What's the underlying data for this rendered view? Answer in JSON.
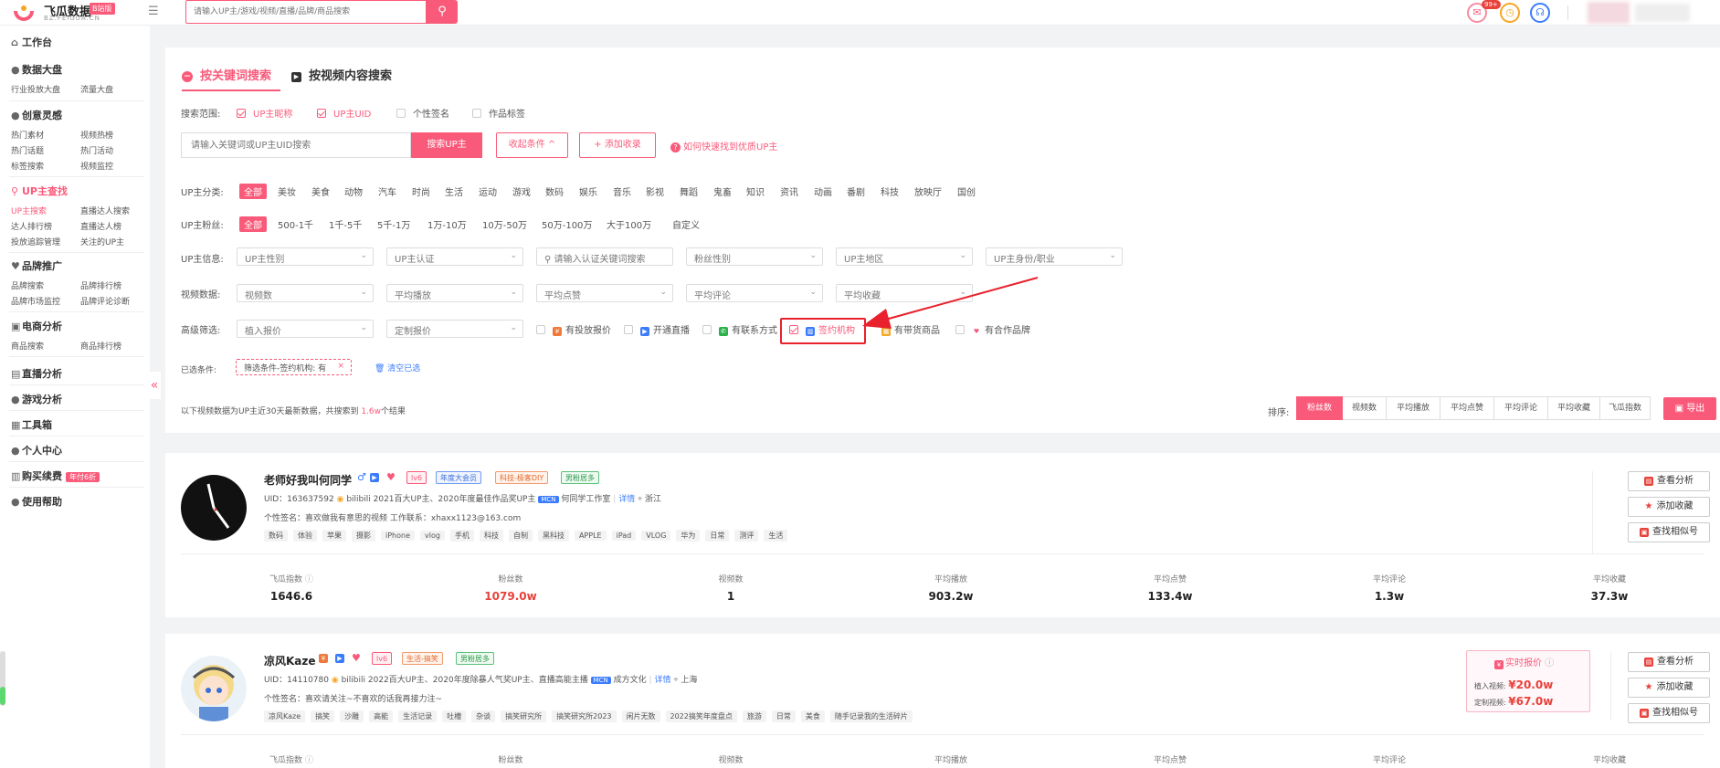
{
  "header": {
    "logo_name": "飞瓜数据",
    "logo_badge": "B站版",
    "logo_domain": "BZ.FEIGUA.CN",
    "search_placeholder": "请输入UP主/游戏/视频/直播/品牌/商品搜索",
    "notification_count": "99+",
    "colors": {
      "accent": "#fa5a7a"
    }
  },
  "sidebar": {
    "workbench": "工作台",
    "data_screen": "数据大盘",
    "data_screen_items": [
      "行业投放大盘",
      "流量大盘"
    ],
    "inspiration": "创意灵感",
    "inspiration_items": [
      "热门素材",
      "视频热榜",
      "热门话题",
      "热门活动",
      "标签搜索",
      "视频监控"
    ],
    "up_search": "UP主查找",
    "up_search_items": [
      "UP主搜索",
      "直播达人搜索",
      "达人排行榜",
      "直播达人榜",
      "投放追踪管理",
      "关注的UP主"
    ],
    "brand": "品牌推广",
    "brand_items": [
      "品牌搜索",
      "品牌排行榜",
      "品牌市场监控",
      "品牌评论诊断"
    ],
    "ecommerce": "电商分析",
    "ecommerce_items": [
      "商品搜索",
      "商品排行榜"
    ],
    "live": "直播分析",
    "game": "游戏分析",
    "tools": "工具箱",
    "personal": "个人中心",
    "purchase": "购买续费",
    "purchase_badge": "年付6折",
    "help": "使用帮助"
  },
  "search_panel": {
    "tab_keyword": "按关键词搜索",
    "tab_video": "按视频内容搜索",
    "scope_label": "搜索范围:",
    "scope_options": [
      {
        "label": "UP主昵称",
        "checked": true
      },
      {
        "label": "UP主UID",
        "checked": true
      },
      {
        "label": "个性签名",
        "checked": false
      },
      {
        "label": "作品标签",
        "checked": false
      }
    ],
    "keyword_placeholder": "请输入关键词或UP主UID搜索",
    "search_button": "搜索UP主",
    "collapse_button": "收起条件 ^",
    "add_favorite_button": "+ 添加收录",
    "help_link": "如何快速找到优质UP主",
    "category_label": "UP主分类:",
    "categories": [
      "全部",
      "美妆",
      "美食",
      "动物",
      "汽车",
      "时尚",
      "生活",
      "运动",
      "游戏",
      "数码",
      "娱乐",
      "音乐",
      "影视",
      "舞蹈",
      "鬼畜",
      "知识",
      "资讯",
      "动画",
      "番剧",
      "科技",
      "放映厅",
      "国创"
    ],
    "fans_label": "UP主粉丝:",
    "fans_ranges": [
      "全部",
      "500-1千",
      "1千-5千",
      "5千-1万",
      "1万-10万",
      "10万-50万",
      "50万-100万",
      "大于100万",
      "自定义"
    ],
    "info_label": "UP主信息:",
    "info_selects": [
      "UP主性别",
      "UP主认证",
      "请输入认证关键词搜索",
      "粉丝性别",
      "UP主地区",
      "UP主身份/职业"
    ],
    "video_label": "视频数据:",
    "video_selects": [
      "视频数",
      "平均播放",
      "平均点赞",
      "平均评论",
      "平均收藏"
    ],
    "advanced_label": "高级筛选:",
    "advanced_selects": [
      "植入报价",
      "定制报价"
    ],
    "advanced_checks": [
      {
        "label": "有投放报价",
        "checked": false,
        "icon_color": "#f07a3c"
      },
      {
        "label": "开通直播",
        "checked": false,
        "icon_color": "#3b7cff"
      },
      {
        "label": "有联系方式",
        "checked": false,
        "icon_color": "#2bb04a"
      },
      {
        "label": "签约机构",
        "checked": true,
        "icon_color": "#3b7cff"
      },
      {
        "label": "有带货商品",
        "checked": false,
        "icon_color": "#f5a623"
      },
      {
        "label": "有合作品牌",
        "checked": false,
        "icon_color": "#fa5a7a"
      }
    ],
    "selected_label": "已选条件:",
    "selected_chip": "筛选条件-签约机构: 有",
    "clear_label": "清空已选"
  },
  "results_bar": {
    "summary_prefix": "以下视频数据为UP主近30天最新数据，共搜索到",
    "summary_count": "1.6w",
    "summary_suffix": "个结果",
    "sort_label": "排序:",
    "sort_options": [
      "粉丝数",
      "视频数",
      "平均播放",
      "平均点赞",
      "平均评论",
      "平均收藏",
      "飞瓜指数"
    ],
    "export_label": "导出"
  },
  "results": [
    {
      "name": "老师好我叫何同学",
      "badges": [
        "lv6",
        "年度大会员",
        "科技-极客DIY",
        "男粉居多"
      ],
      "uid_text": "UID：163637592",
      "honor": "bilibili 2021百大UP主、2020年度最佳作品奖UP主",
      "mcn_label": "MCN",
      "mcn_name": "何同学工作室",
      "detail_link": "详情",
      "location": "浙江",
      "signature": "个性签名：喜欢做我有意思的视频 工作联系：xhaxx1123@163.com",
      "tags": [
        "数码",
        "体验",
        "苹果",
        "摄影",
        "iPhone",
        "vlog",
        "手机",
        "科技",
        "自制",
        "黑科技",
        "APPLE",
        "iPad",
        "VLOG",
        "华为",
        "日常",
        "测评",
        "生活"
      ],
      "stats": [
        {
          "label": "飞瓜指数",
          "value": "1646.6"
        },
        {
          "label": "粉丝数",
          "value": "1079.0w"
        },
        {
          "label": "视频数",
          "value": "1"
        },
        {
          "label": "平均播放",
          "value": "903.2w"
        },
        {
          "label": "平均点赞",
          "value": "133.4w"
        },
        {
          "label": "平均评论",
          "value": "1.3w"
        },
        {
          "label": "平均收藏",
          "value": "37.3w"
        }
      ],
      "actions": [
        "查看分析",
        "添加收藏",
        "查找相似号"
      ]
    },
    {
      "name": "凉风Kaze",
      "badges": [
        "lv6",
        "生活-搞笑",
        "男粉居多"
      ],
      "uid_text": "UID：14110780",
      "honor": "bilibili 2022百大UP主、2020年度除暴人气奖UP主、直播高能主播",
      "mcn_label": "MCN",
      "mcn_name": "成方文化",
      "detail_link": "详情",
      "location": "上海",
      "signature": "个性签名：喜欢请关注~不喜欢的话我再接力注~",
      "tags": [
        "凉风Kaze",
        "搞笑",
        "沙雕",
        "高能",
        "生活记录",
        "吐槽",
        "杂谈",
        "搞笑研究所",
        "搞笑研究所2023",
        "闲片无数",
        "2022搞笑年度盘点",
        "旅游",
        "日常",
        "美食",
        "随手记录我的生活碎片"
      ],
      "price": {
        "title": "实时报价",
        "implant_label": "植入视频:",
        "implant_value": "¥20.0w",
        "custom_label": "定制视频:",
        "custom_value": "¥67.0w"
      },
      "stats": [
        {
          "label": "飞瓜指数"
        },
        {
          "label": "粉丝数"
        },
        {
          "label": "视频数"
        },
        {
          "label": "平均播放"
        },
        {
          "label": "平均点赞"
        },
        {
          "label": "平均评论"
        },
        {
          "label": "平均收藏"
        }
      ],
      "actions": [
        "查看分析",
        "添加收藏",
        "查找相似号"
      ]
    }
  ]
}
